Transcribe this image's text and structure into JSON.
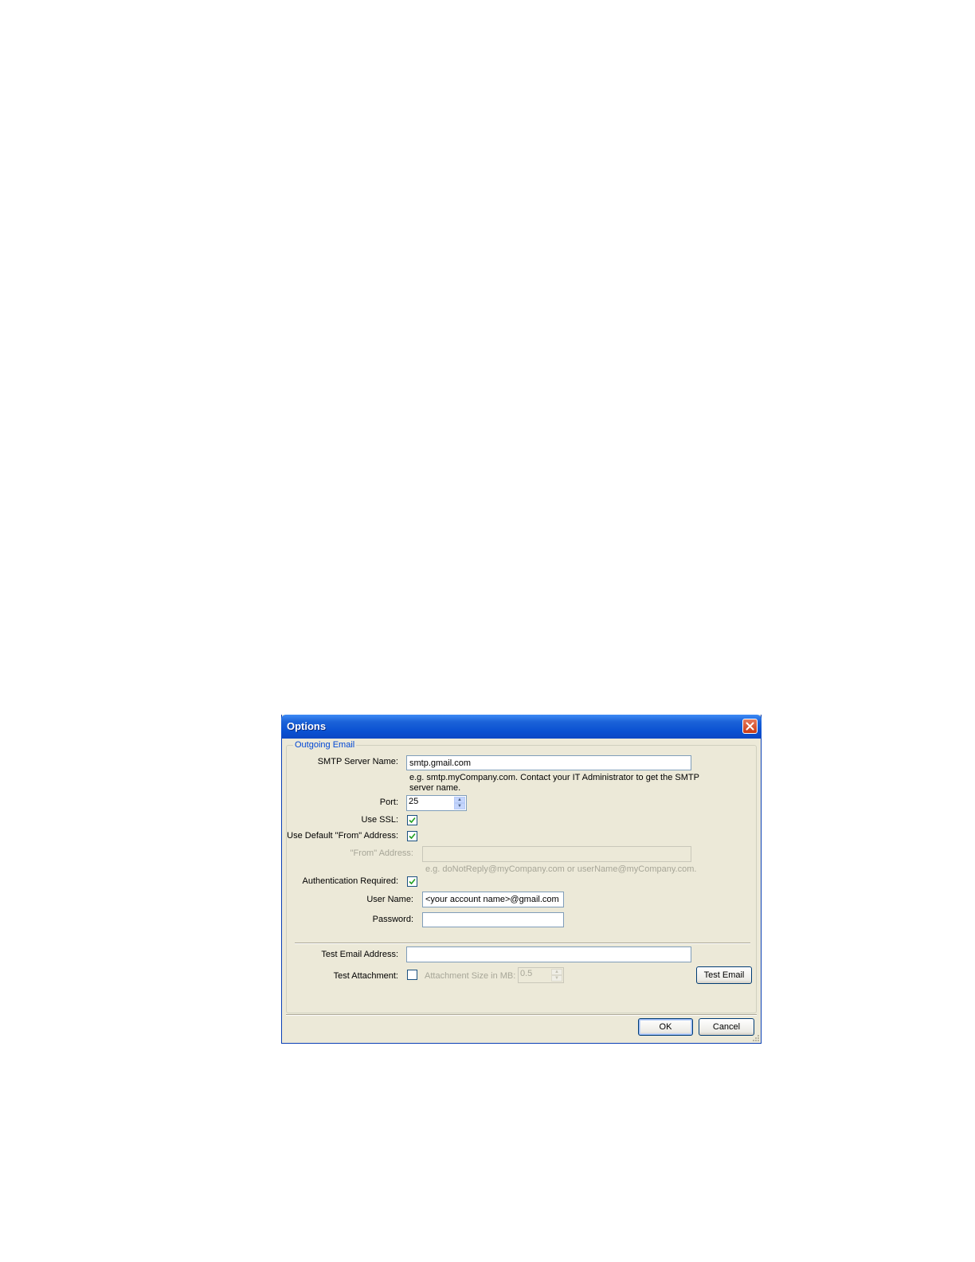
{
  "window": {
    "title": "Options"
  },
  "group": {
    "title": "Outgoing Email"
  },
  "smtp": {
    "label": "SMTP Server Name:",
    "value": "smtp.gmail.com",
    "hint_line1": "e.g.  smtp.myCompany.com. Contact your IT Administrator to get the SMTP",
    "hint_line2": "server name."
  },
  "port": {
    "label": "Port:",
    "value": "25"
  },
  "ssl": {
    "label": "Use SSL:",
    "checked": true
  },
  "default_from": {
    "label": "Use Default \"From\" Address:",
    "checked": true
  },
  "from": {
    "label": "\"From\" Address:",
    "value": "",
    "hint": "e.g. doNotReply@myCompany.com or userName@myCompany.com."
  },
  "auth": {
    "label": "Authentication Required:",
    "checked": true
  },
  "username": {
    "label": "User Name:",
    "value": "<your account name>@gmail.com"
  },
  "password": {
    "label": "Password:",
    "value": ""
  },
  "test_email": {
    "label": "Test Email Address:",
    "value": ""
  },
  "test_attachment": {
    "label": "Test Attachment:",
    "checked": false,
    "size_label": "Attachment Size in MB:",
    "size_value": "0.5"
  },
  "buttons": {
    "test_email": "Test Email",
    "ok": "OK",
    "cancel": "Cancel"
  }
}
